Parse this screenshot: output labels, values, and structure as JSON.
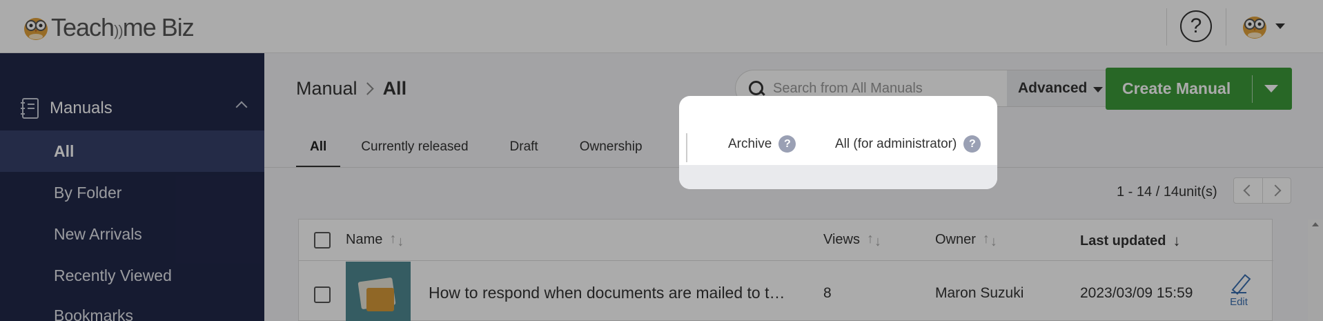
{
  "header": {
    "logo_text": "Teach",
    "logo_text2": "me",
    "logo_text3": "Biz",
    "help_label": "?"
  },
  "sidebar": {
    "section_label": "Manuals",
    "items": [
      {
        "label": "All",
        "active": true
      },
      {
        "label": "By Folder"
      },
      {
        "label": "New Arrivals"
      },
      {
        "label": "Recently Viewed"
      },
      {
        "label": "Bookmarks"
      }
    ]
  },
  "breadcrumb": {
    "root": "Manual",
    "current": "All"
  },
  "search": {
    "placeholder": "Search from All Manuals",
    "advanced_label": "Advanced"
  },
  "create_button": {
    "label": "Create Manual"
  },
  "tabs": [
    {
      "label": "All",
      "active": true
    },
    {
      "label": "Currently released"
    },
    {
      "label": "Draft"
    },
    {
      "label": "Ownership"
    }
  ],
  "popup": {
    "tabs": [
      {
        "label": "Archive",
        "help": "?"
      },
      {
        "label": "All (for administrator)",
        "help": "?"
      }
    ]
  },
  "pagination": {
    "count_text": "1 - 14 / 14unit(s)"
  },
  "table": {
    "columns": {
      "name": "Name",
      "views": "Views",
      "owner": "Owner",
      "last_updated": "Last updated"
    },
    "rows": [
      {
        "title": "How to respond when documents are mailed to t…",
        "views": "8",
        "owner": "Maron Suzuki",
        "updated": "2023/03/09 15:59",
        "edit_label": "Edit"
      }
    ]
  },
  "colors": {
    "sidebar_bg": "#22294a",
    "sidebar_active": "#36406a",
    "create_button": "#3d9a3a",
    "edit_link": "#3a6fb0"
  }
}
